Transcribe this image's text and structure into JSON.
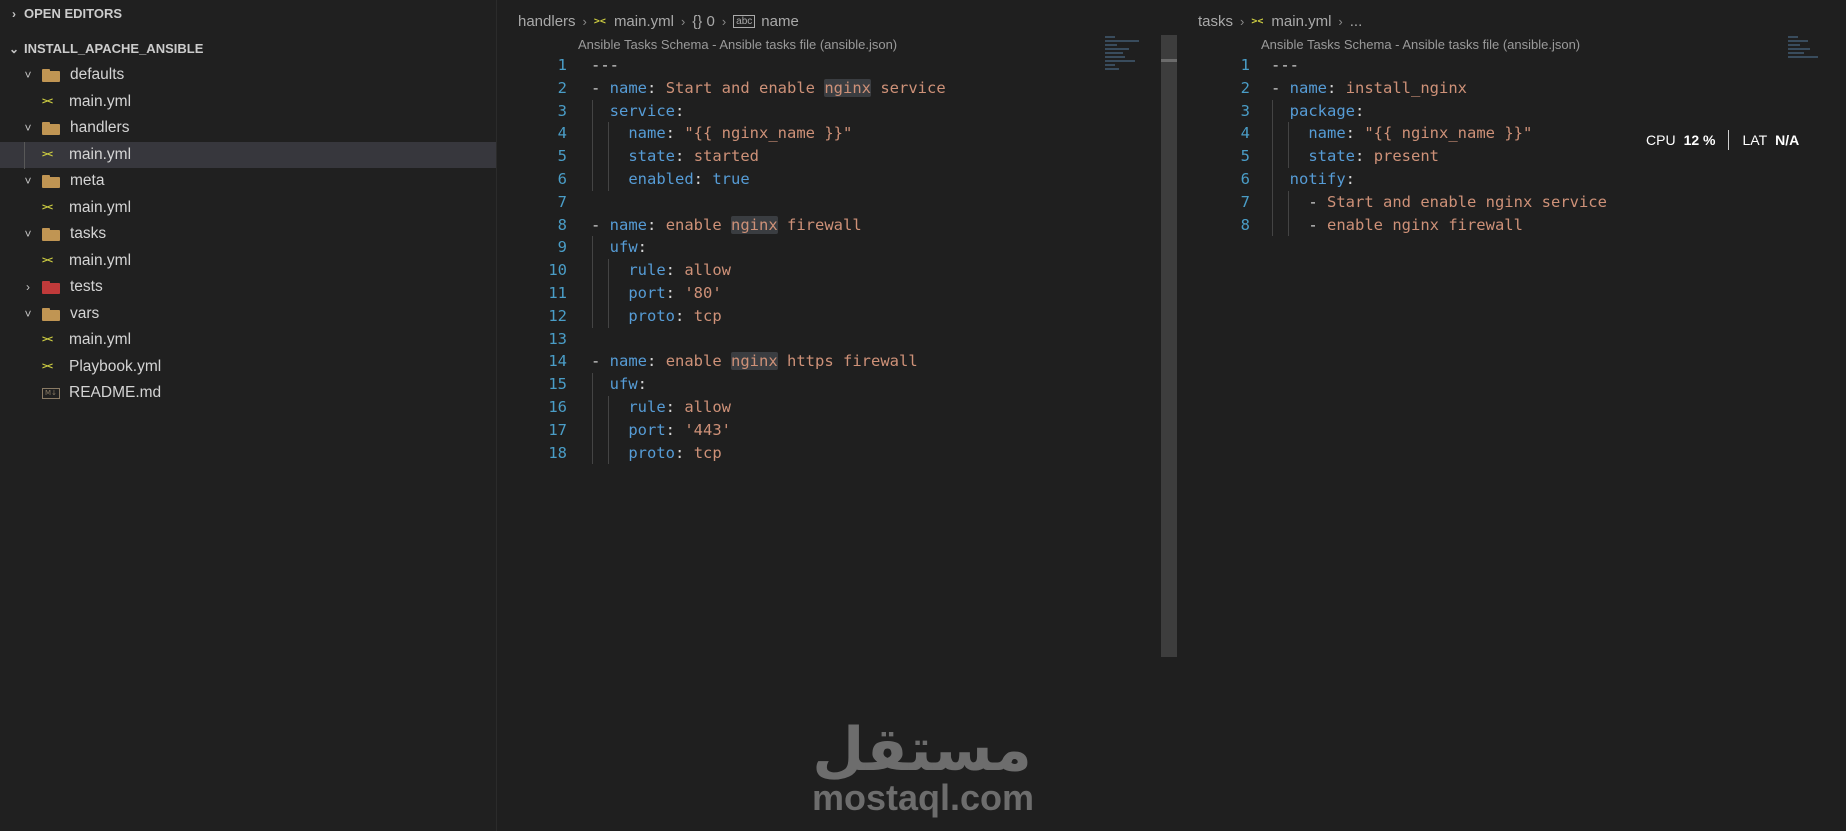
{
  "sidebar": {
    "open_editors": "OPEN EDITORS",
    "project": "INSTALL_APACHE_ANSIBLE",
    "tree": [
      {
        "label": "defaults",
        "type": "folder",
        "depth": 1,
        "expanded": true
      },
      {
        "label": "main.yml",
        "type": "yml",
        "depth": 2
      },
      {
        "label": "handlers",
        "type": "folder",
        "depth": 1,
        "expanded": true
      },
      {
        "label": "main.yml",
        "type": "yml",
        "depth": 2,
        "selected": true
      },
      {
        "label": "meta",
        "type": "folder",
        "depth": 1,
        "expanded": true
      },
      {
        "label": "main.yml",
        "type": "yml",
        "depth": 2
      },
      {
        "label": "tasks",
        "type": "folder",
        "depth": 1,
        "expanded": true
      },
      {
        "label": "main.yml",
        "type": "yml",
        "depth": 2
      },
      {
        "label": "tests",
        "type": "folder-red",
        "depth": 1,
        "expanded": false
      },
      {
        "label": "vars",
        "type": "folder",
        "depth": 1,
        "expanded": true
      },
      {
        "label": "main.yml",
        "type": "yml",
        "depth": 2
      },
      {
        "label": "Playbook.yml",
        "type": "yml",
        "depth": 1
      },
      {
        "label": "README.md",
        "type": "md",
        "depth": 1
      }
    ]
  },
  "left_editor": {
    "breadcrumb": [
      "handlers",
      "main.yml",
      "{} 0",
      "name"
    ],
    "schema": "Ansible Tasks Schema - Ansible tasks file (ansible.json)",
    "lines": [
      "---",
      "- name: Start and enable nginx service",
      "  service:",
      "    name: \"{{ nginx_name }}\"",
      "    state: started",
      "    enabled: true",
      "",
      "- name: enable nginx firewall",
      "  ufw:",
      "    rule: allow",
      "    port: '80'",
      "    proto: tcp",
      "",
      "- name: enable nginx https firewall",
      "  ufw:",
      "    rule: allow",
      "    port: '443'",
      "    proto: tcp"
    ]
  },
  "right_editor": {
    "breadcrumb": [
      "tasks",
      "main.yml",
      "..."
    ],
    "schema": "Ansible Tasks Schema - Ansible tasks file (ansible.json)",
    "lines": [
      "---",
      "- name: install_nginx",
      "  package:",
      "    name: \"{{ nginx_name }}\"",
      "    state: present",
      "  notify:",
      "    - Start and enable nginx service",
      "    - enable nginx firewall"
    ]
  },
  "stats": {
    "cpu_label": "CPU",
    "cpu_value": "12 %",
    "lat_label": "LAT",
    "lat_value": "N/A"
  },
  "watermark": {
    "arabic": "مستقل",
    "english": "mostaql.com"
  }
}
